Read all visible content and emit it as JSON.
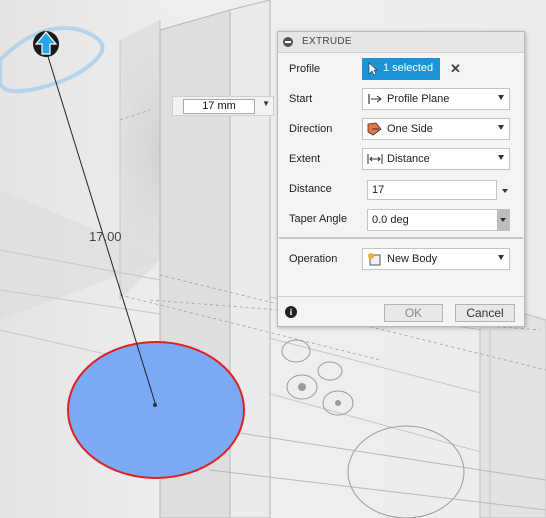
{
  "viewport": {
    "dimension_input_value": "17 mm",
    "dimension_label": "17.00"
  },
  "extrude_panel": {
    "title": "EXTRUDE",
    "profile": {
      "label": "Profile",
      "value": "1 selected"
    },
    "start": {
      "label": "Start",
      "value": "Profile Plane"
    },
    "direction": {
      "label": "Direction",
      "value": "One Side"
    },
    "extent": {
      "label": "Extent",
      "value": "Distance"
    },
    "distance": {
      "label": "Distance",
      "value": "17"
    },
    "taper_angle": {
      "label": "Taper Angle",
      "value": "0.0 deg"
    },
    "operation": {
      "label": "Operation",
      "value": "New Body"
    },
    "ok_label": "OK",
    "cancel_label": "Cancel"
  },
  "colors": {
    "accent_blue": "#1a94d6",
    "profile_fill": "#7aaaf5",
    "profile_outline": "#e02020"
  }
}
